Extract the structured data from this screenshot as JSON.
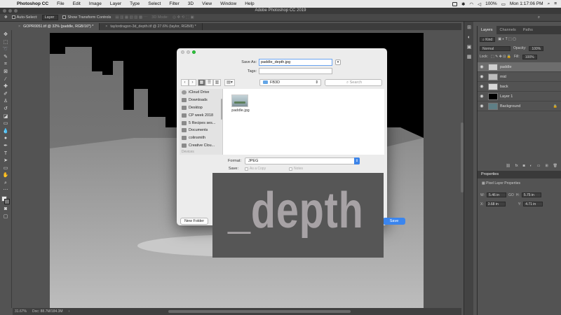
{
  "menubar": {
    "app": "Photoshop CC",
    "items": [
      "File",
      "Edit",
      "Image",
      "Layer",
      "Type",
      "Select",
      "Filter",
      "3D",
      "View",
      "Window",
      "Help"
    ],
    "battery": "100%",
    "clock": "Mon 1:17:06 PM"
  },
  "window_title": "Adobe Photoshop CC 2019",
  "options": {
    "auto_select": "Auto-Select:",
    "layer_select": "Layer",
    "show_transform": "Show Transform Controls",
    "mode_3d": "3D Mode:"
  },
  "tabs": [
    {
      "label": "GOPR0051.tif @ 32% (paddle, RGB/16*) *",
      "active": true
    },
    {
      "label": "taylordragon-3d_depth.tif @ 27.6% (taylor, RGB/8) *",
      "active": false
    }
  ],
  "status": {
    "zoom": "31.67%",
    "doc": "Doc: 88.7M/184.3M"
  },
  "panel": {
    "tabs": [
      "Layers",
      "Channels",
      "Paths"
    ],
    "filter_label": "Kind",
    "blend_mode": "Normal",
    "opacity_label": "Opacity:",
    "opacity_value": "100%",
    "lock_label": "Lock:",
    "fill_label": "Fill:",
    "fill_value": "100%",
    "layers": [
      {
        "name": "paddle",
        "selected": true,
        "thumb": "#cfcfcf"
      },
      {
        "name": "mid",
        "selected": false,
        "thumb": "#bcbcbc"
      },
      {
        "name": "back",
        "selected": false,
        "thumb": "#d6d6d6"
      },
      {
        "name": "Layer 1",
        "selected": false,
        "thumb": "#000000"
      },
      {
        "name": "Background",
        "selected": false,
        "thumb": "#5f7f86"
      }
    ],
    "properties_title": "Properties",
    "properties_subtitle": "Pixel Layer Properties",
    "props": {
      "w_label": "W:",
      "w_value": "5.46 in",
      "go_label": "GO",
      "h_label": "H:",
      "h_value": "5.75 in",
      "x_label": "X:",
      "x_value": "3.68 in",
      "y_label": "Y:",
      "y_value": "4.71 in"
    }
  },
  "dialog": {
    "save_as_label": "Save As:",
    "save_as_value": "paddle_depth.jpg",
    "tags_label": "Tags:",
    "location": "FB3D",
    "search_placeholder": "Search",
    "sidebar": [
      "iCloud Drive",
      "Downloads",
      "Desktop",
      "CP week 2018",
      "5 Recipes ses...",
      "Documents",
      "colinsmith",
      "Creative Clou...",
      "Devices"
    ],
    "file": "paddle.jpg",
    "format_label": "Format:",
    "format_value": "JPEG",
    "save_label": "Save:",
    "as_copy": "As a Copy",
    "notes": "Notes",
    "new_folder": "New Folder",
    "save_button": "Save"
  },
  "overlay_text": "_depth",
  "colors": {
    "accent": "#3a85ee",
    "panel_bg": "#535353",
    "dialog_bg": "#ececec"
  }
}
